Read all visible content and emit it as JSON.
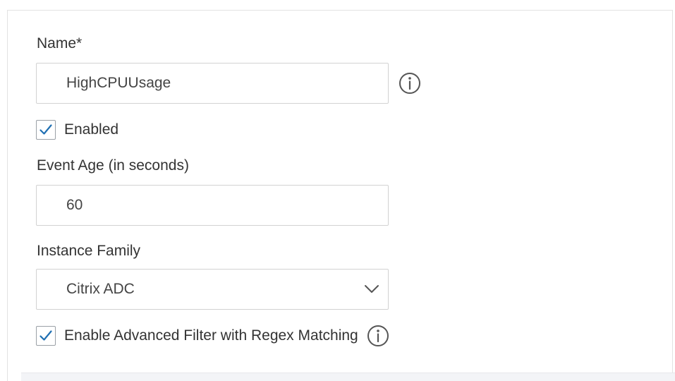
{
  "form": {
    "name": {
      "label": "Name*",
      "value": "HighCPUUsage",
      "info_icon": "info-icon"
    },
    "enabled": {
      "label": "Enabled",
      "checked": true
    },
    "event_age": {
      "label": "Event Age (in seconds)",
      "value": "60"
    },
    "instance_family": {
      "label": "Instance Family",
      "selected": "Citrix ADC",
      "dropdown_icon": "chevron-down-icon"
    },
    "advanced_filter": {
      "label": "Enable Advanced Filter with Regex Matching",
      "checked": true,
      "info_icon": "info-icon"
    }
  },
  "colors": {
    "check": "#1f6fb2",
    "border": "#d2d2d2",
    "text": "#333333"
  }
}
